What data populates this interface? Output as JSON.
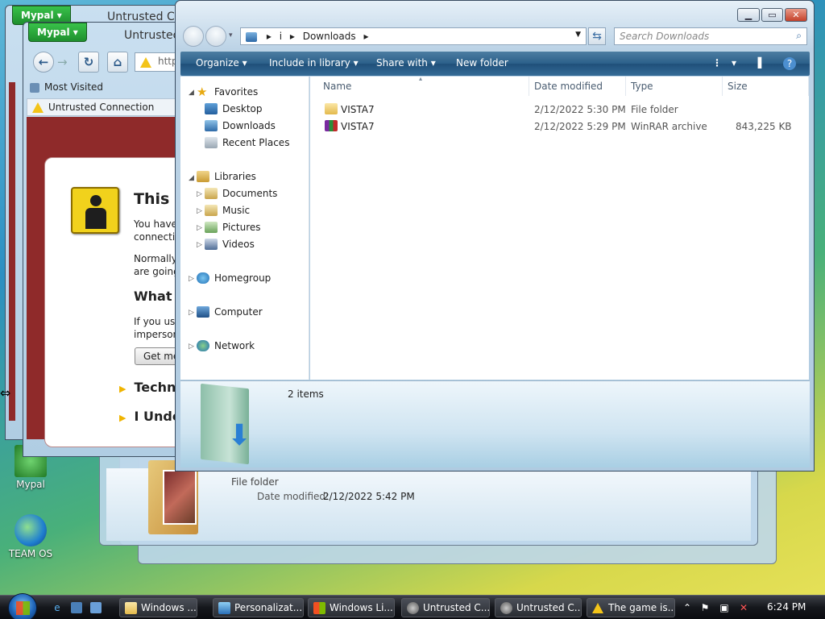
{
  "desktop": {
    "icons": [
      {
        "label": "Mypal"
      },
      {
        "label": "TEAM OS"
      }
    ]
  },
  "background_window": {
    "file_type": "File folder",
    "date_label": "Date modified:",
    "date_value": "2/12/2022 5:42 PM"
  },
  "mypal_back": {
    "tab_label": "Mypal",
    "title": "Untrusted Co"
  },
  "mypal_front": {
    "tab_label": "Mypal",
    "title": "Untrusted",
    "url": "http",
    "bookmark": "Most Visited",
    "page_tab": "Untrusted Connection",
    "error": {
      "title": "This C",
      "line1": "You have",
      "line2": "connectio",
      "line3": "Normally,",
      "line4": "are going",
      "heading": "What S",
      "line5": "If you usu",
      "line6": "imperson",
      "button": "Get me",
      "expander1": "Techn",
      "expander2": "I Unde"
    }
  },
  "explorer": {
    "address": {
      "path": [
        "i",
        "Downloads"
      ]
    },
    "search_placeholder": "Search Downloads",
    "toolbar": {
      "organize": "Organize",
      "include_in_library": "Include in library",
      "share_with": "Share with",
      "new_folder": "New folder"
    },
    "nav": {
      "favorites": "Favorites",
      "desktop": "Desktop",
      "downloads": "Downloads",
      "recent_places": "Recent Places",
      "libraries": "Libraries",
      "documents": "Documents",
      "music": "Music",
      "pictures": "Pictures",
      "videos": "Videos",
      "homegroup": "Homegroup",
      "computer": "Computer",
      "network": "Network"
    },
    "columns": {
      "name": "Name",
      "date_modified": "Date modified",
      "type": "Type",
      "size": "Size"
    },
    "files": [
      {
        "name": "VISTA7",
        "date": "2/12/2022 5:30 PM",
        "type": "File folder",
        "size": ""
      },
      {
        "name": "VISTA7",
        "date": "2/12/2022 5:29 PM",
        "type": "WinRAR archive",
        "size": "843,225 KB"
      }
    ],
    "details": {
      "item_count": "2 items"
    }
  },
  "taskbar": {
    "buttons": [
      {
        "label": "Windows ..."
      },
      {
        "label": "Personalizat..."
      },
      {
        "label": "Windows Li..."
      },
      {
        "label": "Untrusted C..."
      },
      {
        "label": "Untrusted C..."
      },
      {
        "label": "The game is..."
      }
    ],
    "clock": "6:24 PM"
  },
  "colors": {
    "explorer_toolbar": "#2b5f89",
    "mypal_green": "#1e8f2e",
    "error_red": "#8f2a2a",
    "warning_yellow": "#f3c419"
  }
}
